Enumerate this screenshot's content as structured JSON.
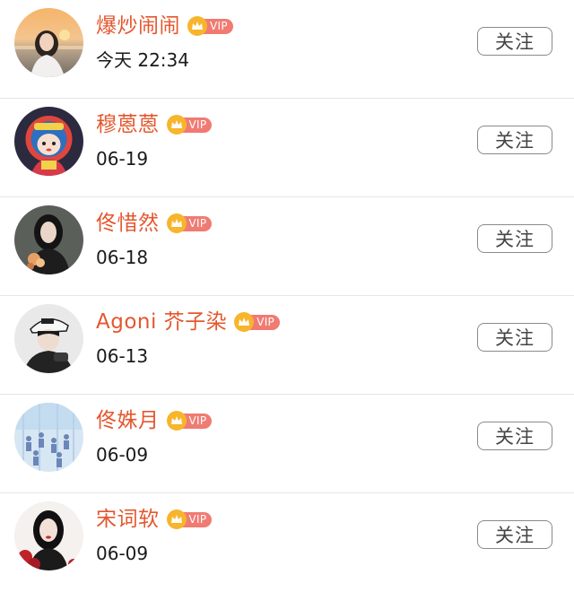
{
  "vip_label": "VIP",
  "follow_label": "关注",
  "colors": {
    "name": "#e4572e",
    "vip_badge": "#f07b73",
    "crown": "#f7b52c",
    "divider": "#e6e6e6"
  },
  "users": [
    {
      "name": "爆炒闹闹",
      "time": "今天 22:34",
      "avatar": "avatar-sunset-girl"
    },
    {
      "name": "穆蒽蒽",
      "time": "06-19",
      "avatar": "avatar-lion-cartoon"
    },
    {
      "name": "佟惜然",
      "time": "06-18",
      "avatar": "avatar-girl-dark-hair"
    },
    {
      "name": "Agoni 芥子染",
      "time": "06-13",
      "avatar": "avatar-girl-cap"
    },
    {
      "name": "佟姝月",
      "time": "06-09",
      "avatar": "avatar-blue-crowd"
    },
    {
      "name": "宋词软",
      "time": "06-09",
      "avatar": "avatar-girl-roses"
    }
  ]
}
